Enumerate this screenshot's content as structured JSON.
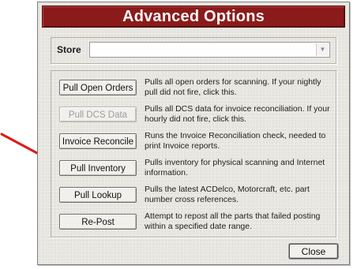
{
  "dialog": {
    "title": "Advanced Options",
    "store": {
      "label": "Store",
      "value": ""
    },
    "options": [
      {
        "button": "Pull Open Orders",
        "enabled": true,
        "description": "Pulls all open orders for scanning. If your nightly pull did not fire, click this."
      },
      {
        "button": "Pull DCS Data",
        "enabled": false,
        "description": "Pulls all DCS data for invoice reconciliation. If your hourly did not fire, click this."
      },
      {
        "button": "Invoice Reconcile",
        "enabled": true,
        "description": "Runs the Invoice Reconciliation check, needed to print Invoice reports."
      },
      {
        "button": "Pull Inventory",
        "enabled": true,
        "description": "Pulls inventory for physical scanning and Internet information."
      },
      {
        "button": "Pull Lookup",
        "enabled": true,
        "description": "Pulls the latest ACDelco, Motorcraft, etc. part number cross references."
      },
      {
        "button": "Re-Post",
        "enabled": true,
        "description": "Attempt to repost all the parts that failed posting within a specified date range."
      }
    ],
    "close_label": "Close"
  },
  "annotation": {
    "arrow_color": "#e01818",
    "points_to": "Pull Inventory"
  },
  "colors": {
    "title_bar": "#8b1b1b",
    "dialog_bg": "#e9e7e2"
  }
}
